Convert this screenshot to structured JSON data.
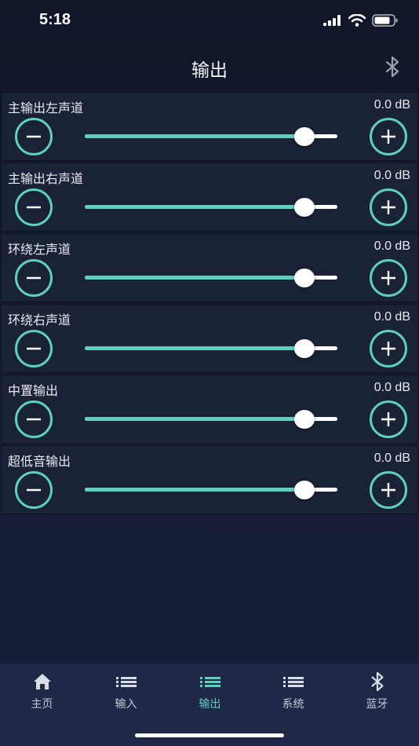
{
  "status": {
    "time": "5:18"
  },
  "nav": {
    "title": "输出",
    "icon": "bluetooth-icon"
  },
  "channels": [
    {
      "label": "主输出左声道",
      "value": "0.0 dB",
      "level": 0.87
    },
    {
      "label": "主输出右声道",
      "value": "0.0 dB",
      "level": 0.87
    },
    {
      "label": "环绕左声道",
      "value": "0.0 dB",
      "level": 0.87
    },
    {
      "label": "环绕右声道",
      "value": "0.0 dB",
      "level": 0.87
    },
    {
      "label": "中置输出",
      "value": "0.0 dB",
      "level": 0.87
    },
    {
      "label": "超低音输出",
      "value": "0.0 dB",
      "level": 0.87
    }
  ],
  "tabs": [
    {
      "label": "主页",
      "icon": "home-icon"
    },
    {
      "label": "输入",
      "icon": "list-icon"
    },
    {
      "label": "输出",
      "icon": "list-icon",
      "active": true
    },
    {
      "label": "系统",
      "icon": "list-icon"
    },
    {
      "label": "蓝牙",
      "icon": "bluetooth-icon"
    }
  ],
  "colors": {
    "accent": "#5ed0bd",
    "panel": "#1a2237",
    "background": "#141b30",
    "tabbar": "#1f2947"
  }
}
